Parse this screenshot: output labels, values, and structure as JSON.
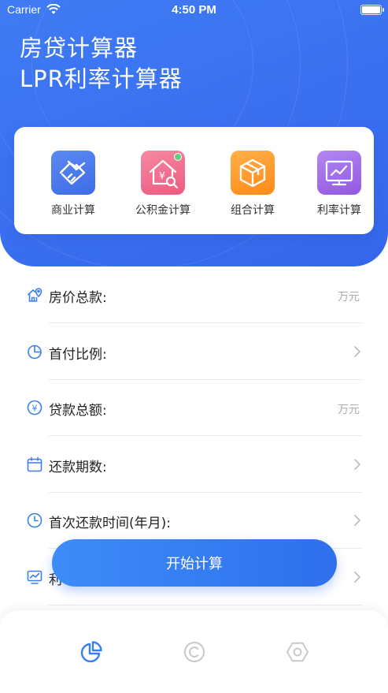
{
  "status_bar": {
    "carrier": "Carrier",
    "time": "4:50 PM"
  },
  "header": {
    "title_line1": "房贷计算器",
    "title_line2": "LPR利率计算器"
  },
  "tools": [
    {
      "label": "商业计算",
      "icon": "handshake-icon",
      "color": "#4a78ee"
    },
    {
      "label": "公积金计算",
      "icon": "house-yuan-search-icon",
      "color": "#f06b8c"
    },
    {
      "label": "组合计算",
      "icon": "cube-box-icon",
      "color": "#ff9a2a"
    },
    {
      "label": "利率计算",
      "icon": "monitor-chart-icon",
      "color": "#a06ce6"
    }
  ],
  "form": {
    "rows": [
      {
        "label": "房价总款:",
        "unit": "万元",
        "icon": "house-location-icon"
      },
      {
        "label": "首付比例:",
        "icon": "pie-chart-icon"
      },
      {
        "label": "贷款总额:",
        "unit": "万元",
        "icon": "yuan-circle-icon"
      },
      {
        "label": "还款期数:",
        "icon": "calendar-icon"
      },
      {
        "label": "首次还款时间(年月):",
        "icon": "clock-icon"
      },
      {
        "label": "利",
        "icon": "monitor-chart-icon"
      }
    ]
  },
  "primary_button": {
    "label": "开始计算"
  },
  "tab_bar": {
    "tabs": [
      {
        "icon": "pie-chart-icon",
        "active": true
      },
      {
        "icon": "copyright-icon",
        "active": false
      },
      {
        "icon": "hexagon-nut-icon",
        "active": false
      }
    ]
  },
  "colors": {
    "accent": "#3a6ff0",
    "active_tab": "#3a7ff2",
    "inactive_tab": "#c9c9c9"
  }
}
